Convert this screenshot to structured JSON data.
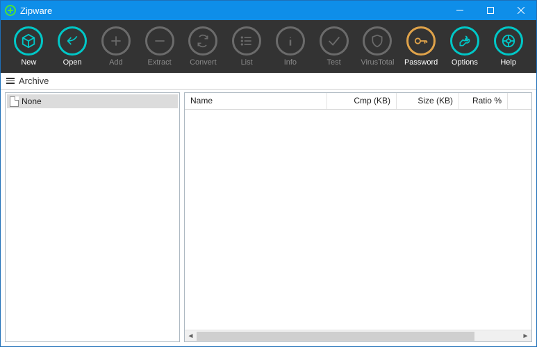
{
  "titlebar": {
    "title": "Zipware"
  },
  "toolbar": {
    "items": [
      {
        "id": "new",
        "label": "New",
        "enabled": true,
        "accent": "teal"
      },
      {
        "id": "open",
        "label": "Open",
        "enabled": true,
        "accent": "teal"
      },
      {
        "id": "add",
        "label": "Add",
        "enabled": false,
        "accent": "teal"
      },
      {
        "id": "extract",
        "label": "Extract",
        "enabled": false,
        "accent": "teal"
      },
      {
        "id": "convert",
        "label": "Convert",
        "enabled": false,
        "accent": "teal"
      },
      {
        "id": "list",
        "label": "List",
        "enabled": false,
        "accent": "teal"
      },
      {
        "id": "info",
        "label": "Info",
        "enabled": false,
        "accent": "teal"
      },
      {
        "id": "test",
        "label": "Test",
        "enabled": false,
        "accent": "teal"
      },
      {
        "id": "virustotal",
        "label": "VirusTotal",
        "enabled": false,
        "accent": "teal"
      },
      {
        "id": "password",
        "label": "Password",
        "enabled": true,
        "accent": "orange"
      },
      {
        "id": "options",
        "label": "Options",
        "enabled": true,
        "accent": "teal"
      },
      {
        "id": "help",
        "label": "Help",
        "enabled": true,
        "accent": "teal"
      }
    ]
  },
  "breadcrumb": {
    "label": "Archive"
  },
  "tree": {
    "items": [
      {
        "label": "None",
        "selected": true
      }
    ]
  },
  "list": {
    "columns": {
      "name": "Name",
      "cmp": "Cmp (KB)",
      "size": "Size (KB)",
      "ratio": "Ratio %"
    },
    "rows": []
  },
  "colors": {
    "titlebar": "#0e8ee9",
    "toolbar_bg": "#333333",
    "accent_teal": "#00c7c7",
    "accent_orange": "#e0a34a",
    "disabled": "#6b6b6b"
  }
}
